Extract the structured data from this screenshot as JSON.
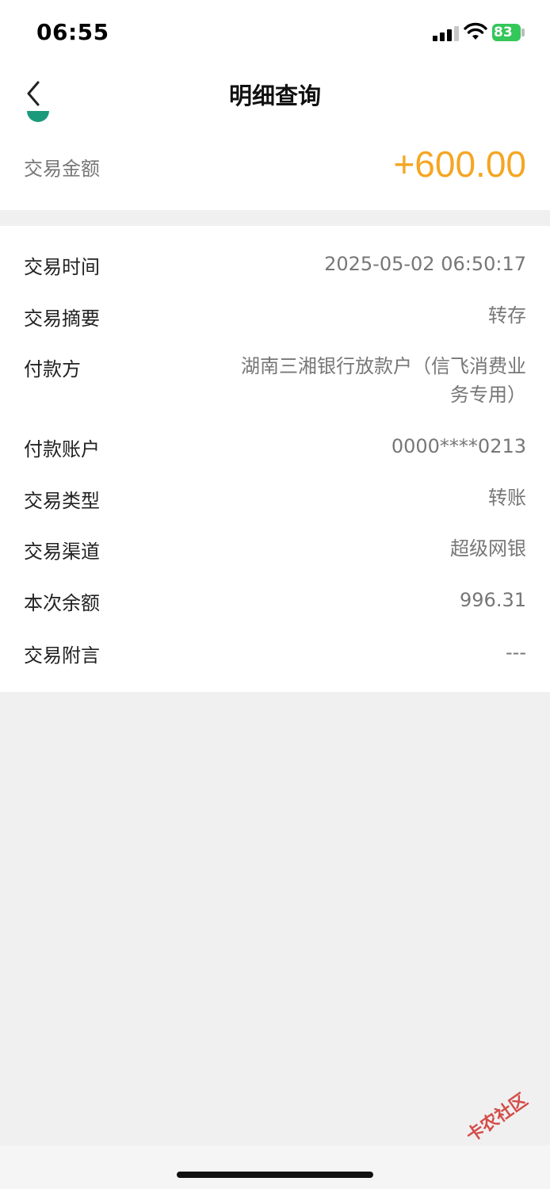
{
  "status_bar": {
    "time": "06:55",
    "battery": "83"
  },
  "nav": {
    "title": "明细查询",
    "back_icon": "chevron-left-icon"
  },
  "summary": {
    "amount_label": "交易金额",
    "amount_value": "+600.00",
    "amount_color": "#f5a623"
  },
  "details": [
    {
      "label": "交易时间",
      "value": "2025-05-02 06:50:17"
    },
    {
      "label": "交易摘要",
      "value": "转存"
    },
    {
      "label": "付款方",
      "value": "湖南三湘银行放款户（信飞消费业务专用）"
    },
    {
      "label": "付款账户",
      "value": "0000****0213"
    },
    {
      "label": "交易类型",
      "value": "转账"
    },
    {
      "label": "交易渠道",
      "value": "超级网银"
    },
    {
      "label": "本次余额",
      "value": "996.31"
    },
    {
      "label": "交易附言",
      "value": "---"
    }
  ],
  "watermark": "卡农社区"
}
